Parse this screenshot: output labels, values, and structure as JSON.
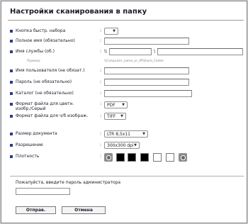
{
  "page": {
    "title": "Настройки сканирования в папку"
  },
  "fields": {
    "quick_dial": {
      "label": "Кнопка быстр. набора",
      "value": ""
    },
    "full_name": {
      "label": "Полное имя (обязательно)",
      "value": ""
    },
    "service_name": {
      "label": "Имя службы (об.)",
      "prefix": "\\\\",
      "separator": "\\",
      "host_value": "",
      "share_value": "",
      "example_label": "Пример:",
      "example_text": "\\\\Computer_name_or_IP\\Share_Folder"
    },
    "user_name": {
      "label": "Имя пользователя (не обязат.)",
      "value": ""
    },
    "password": {
      "label": "Пароль (не обязательно)",
      "value": ""
    },
    "directory": {
      "label": "Каталог (не обязательно)",
      "value": ""
    },
    "color_format": {
      "label_line1": "Формат файла для цветн.",
      "label_line2": "изобр./Серый",
      "value": "PDF"
    },
    "bw_format": {
      "label": "Формат файла для ч/б изображ.",
      "value": "TIFF"
    },
    "doc_size": {
      "label": "Размер документа",
      "value": "LTR 8,5x11"
    },
    "resolution": {
      "label": "Разрешение",
      "value": "300x300 dpi"
    },
    "density": {
      "label": "Плотность",
      "levels": 7,
      "selected_level": 4
    }
  },
  "colon": ":",
  "admin": {
    "label": "Пожалуйста, введите пароль администратора",
    "value": ""
  },
  "buttons": {
    "send": "Отправ.",
    "cancel": "Отмена"
  }
}
